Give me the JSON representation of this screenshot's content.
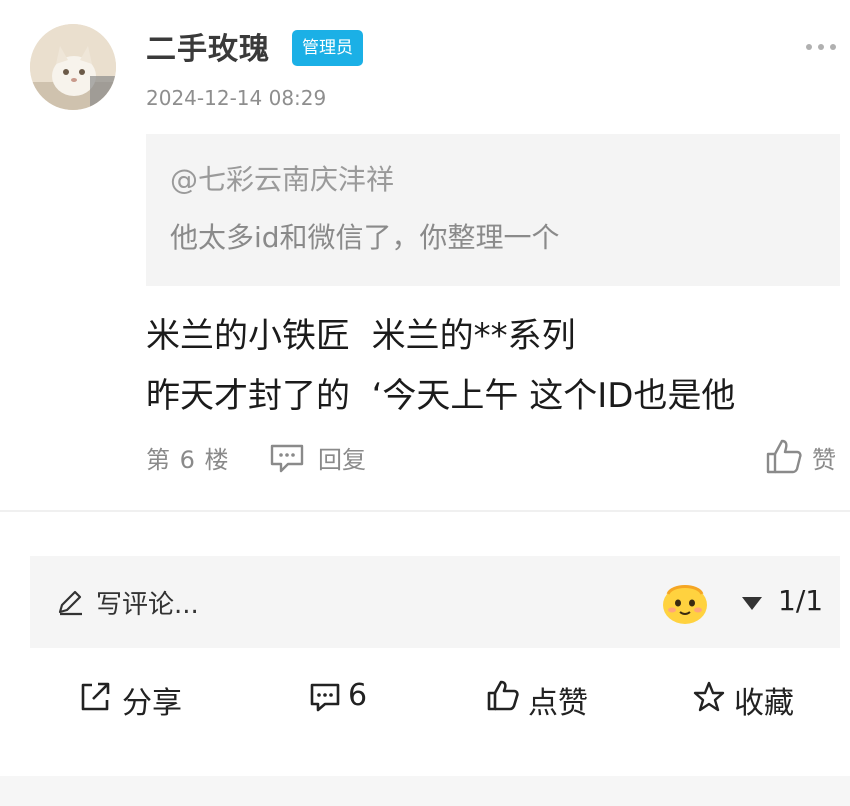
{
  "post": {
    "username": "二手玫瑰",
    "badge": "管理员",
    "timestamp": "2024-12-14 08:29",
    "quote": {
      "mention": "@七彩云南庆沣祥",
      "text": "他太多id和微信了，你整理一个"
    },
    "content": {
      "line1": "米兰的小铁匠  米兰的**系列",
      "line2": "昨天才封了的  ‘今天上午 这个ID也是他"
    },
    "floor": "第 6 楼",
    "reply_label": "回复",
    "like_label": "赞"
  },
  "comment_bar": {
    "placeholder": "写评论...",
    "page_indicator": "1/1"
  },
  "actions": {
    "share_label": "分享",
    "comment_count": "6",
    "like_label": "点赞",
    "favorite_label": "收藏"
  },
  "colors": {
    "badge": "#1bb0e6",
    "quote_bg": "#f4f4f4",
    "muted_text": "#8a8a8a"
  },
  "icons": [
    "more-icon",
    "reply-icon",
    "thumbs-up-icon",
    "pencil-icon",
    "emoji-icon",
    "dropdown-icon",
    "share-icon",
    "comment-icon",
    "star-icon"
  ]
}
